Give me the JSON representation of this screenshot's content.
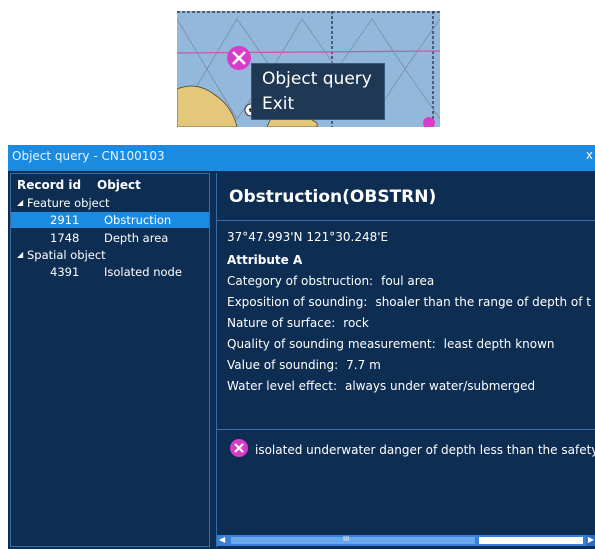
{
  "context_menu": {
    "items": [
      "Object query",
      "Exit"
    ]
  },
  "dialog": {
    "title": "Object query - CN100103",
    "close_label": "x",
    "tree": {
      "headers": {
        "record_id": "Record id",
        "object": "Object"
      },
      "groups": [
        {
          "label": "Feature object",
          "rows": [
            {
              "id": "2911",
              "object": "Obstruction",
              "selected": true
            },
            {
              "id": "1748",
              "object": "Depth area",
              "selected": false
            }
          ]
        },
        {
          "label": "Spatial object",
          "rows": [
            {
              "id": "4391",
              "object": "Isolated node",
              "selected": false
            }
          ]
        }
      ]
    },
    "detail": {
      "title": "Obstruction(OBSTRN)",
      "coordinates": "37°47.993'N 121°30.248'E",
      "attribute_heading": "Attribute A",
      "attributes": [
        {
          "label": "Category of obstruction:",
          "value": "foul area"
        },
        {
          "label": "Exposition of sounding:",
          "value": "shoaler than the range of depth of t"
        },
        {
          "label": "Nature of surface:",
          "value": "rock"
        },
        {
          "label": "Quality of sounding measurement:",
          "value": "least depth known"
        },
        {
          "label": "Value of sounding:",
          "value": "7.7 m"
        },
        {
          "label": "Water level effect:",
          "value": "always under water/submerged"
        }
      ],
      "symbol_description": "isolated underwater danger of depth less than the safety"
    },
    "scrollbar_thumb_label": "III"
  },
  "colors": {
    "titlebar": "#1a8be0",
    "panel": "#0d2d52",
    "selection": "#1a8be0",
    "danger_symbol": "#d83cc8"
  }
}
